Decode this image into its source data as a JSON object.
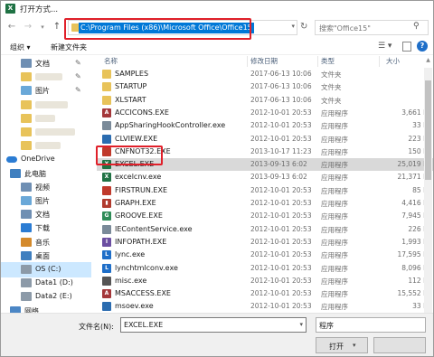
{
  "window": {
    "title": "打开方式...",
    "app_icon_letter": "X"
  },
  "address_bar": {
    "path": "C:\\Program Files (x86)\\Microsoft Office\\Office15",
    "search_placeholder": "搜索\"Office15\""
  },
  "toolbar": {
    "organize_label": "组织 ▾",
    "new_folder_label": "新建文件夹"
  },
  "sidebar": {
    "items": [
      {
        "label": "文档",
        "icon": "document-folder-icon",
        "pinned": true
      },
      {
        "label": "",
        "icon": "folder-icon",
        "pinned": true
      },
      {
        "label": "图片",
        "icon": "pictures-folder-icon",
        "pinned": true
      },
      {
        "label": "",
        "icon": "folder-icon",
        "pinned": false
      },
      {
        "label": "",
        "icon": "folder-icon",
        "pinned": false
      },
      {
        "label": "",
        "icon": "folder-icon",
        "pinned": false
      },
      {
        "label": "",
        "icon": "folder-icon",
        "pinned": false
      },
      {
        "label": "OneDrive",
        "icon": "onedrive-icon",
        "pinned": false
      },
      {
        "label": "此电脑",
        "icon": "this-pc-icon",
        "pinned": false
      },
      {
        "label": "视频",
        "icon": "videos-folder-icon",
        "pinned": false
      },
      {
        "label": "图片",
        "icon": "pictures-folder-icon",
        "pinned": false
      },
      {
        "label": "文档",
        "icon": "document-folder-icon",
        "pinned": false
      },
      {
        "label": "下载",
        "icon": "downloads-folder-icon",
        "pinned": false
      },
      {
        "label": "音乐",
        "icon": "music-folder-icon",
        "pinned": false
      },
      {
        "label": "桌面",
        "icon": "desktop-folder-icon",
        "pinned": false
      },
      {
        "label": "OS (C:)",
        "icon": "drive-icon",
        "pinned": false
      },
      {
        "label": "Data1 (D:)",
        "icon": "drive-icon",
        "pinned": false
      },
      {
        "label": "Data2 (E:)",
        "icon": "drive-icon",
        "pinned": false
      },
      {
        "label": "网络",
        "icon": "network-icon",
        "pinned": false
      }
    ]
  },
  "columns": {
    "name": "名称",
    "date": "修改日期",
    "type": "类型",
    "size": "大小"
  },
  "files": [
    {
      "name": "SAMPLES",
      "date": "2017-06-13 10:06",
      "type": "文件夹",
      "size": "",
      "icon": "folder-icon",
      "color": "#e8c35a"
    },
    {
      "name": "STARTUP",
      "date": "2017-06-13 10:06",
      "type": "文件夹",
      "size": "",
      "icon": "folder-icon",
      "color": "#e8c35a"
    },
    {
      "name": "XLSTART",
      "date": "2017-06-13 10:06",
      "type": "文件夹",
      "size": "",
      "icon": "folder-icon",
      "color": "#e8c35a"
    },
    {
      "name": "ACCICONS.EXE",
      "date": "2012-10-01 20:53",
      "type": "应用程序",
      "size": "3,661 K",
      "icon": "access-icon",
      "color": "#a4373a"
    },
    {
      "name": "AppSharingHookController.exe",
      "date": "2012-10-01 20:53",
      "type": "应用程序",
      "size": "33 K",
      "icon": "exe-icon",
      "color": "#7a8a99"
    },
    {
      "name": "CLVIEW.EXE",
      "date": "2012-10-01 20:53",
      "type": "应用程序",
      "size": "223 K",
      "icon": "exe-icon",
      "color": "#2b6cb0"
    },
    {
      "name": "CNFNOT32.EXE",
      "date": "2013-10-17 11:23",
      "type": "应用程序",
      "size": "150 K",
      "icon": "exe-icon",
      "color": "#c0392b"
    },
    {
      "name": "EXCEL.EXE",
      "date": "2013-09-13 6:02",
      "type": "应用程序",
      "size": "25,019 K",
      "icon": "excel-icon",
      "color": "#1f7244",
      "selected": true
    },
    {
      "name": "excelcnv.exe",
      "date": "2013-09-13 6:02",
      "type": "应用程序",
      "size": "21,371 K",
      "icon": "excel-icon",
      "color": "#1f7244"
    },
    {
      "name": "FIRSTRUN.EXE",
      "date": "2012-10-01 20:53",
      "type": "应用程序",
      "size": "85 K",
      "icon": "exe-icon",
      "color": "#c0392b"
    },
    {
      "name": "GRAPH.EXE",
      "date": "2012-10-01 20:53",
      "type": "应用程序",
      "size": "4,416 K",
      "icon": "graph-icon",
      "color": "#b03a2e"
    },
    {
      "name": "GROOVE.EXE",
      "date": "2012-10-01 20:53",
      "type": "应用程序",
      "size": "7,945 K",
      "icon": "groove-icon",
      "color": "#2e8b57"
    },
    {
      "name": "IEContentService.exe",
      "date": "2012-10-01 20:53",
      "type": "应用程序",
      "size": "226 K",
      "icon": "exe-icon",
      "color": "#7a8a99"
    },
    {
      "name": "INFOPATH.EXE",
      "date": "2012-10-01 20:53",
      "type": "应用程序",
      "size": "1,993 K",
      "icon": "infopath-icon",
      "color": "#6b4ea1"
    },
    {
      "name": "lync.exe",
      "date": "2012-10-01 20:53",
      "type": "应用程序",
      "size": "17,595 K",
      "icon": "lync-icon",
      "color": "#1e6ec8"
    },
    {
      "name": "lynchtmlconv.exe",
      "date": "2012-10-01 20:53",
      "type": "应用程序",
      "size": "8,096 K",
      "icon": "lync-icon",
      "color": "#1e6ec8"
    },
    {
      "name": "misc.exe",
      "date": "2012-10-01 20:53",
      "type": "应用程序",
      "size": "112 K",
      "icon": "exe-icon",
      "color": "#555555"
    },
    {
      "name": "MSACCESS.EXE",
      "date": "2012-10-01 20:53",
      "type": "应用程序",
      "size": "15,552 K",
      "icon": "access-icon",
      "color": "#a4373a"
    },
    {
      "name": "msoev.exe",
      "date": "2012-10-01 20:53",
      "type": "应用程序",
      "size": "33 K",
      "icon": "exe-icon",
      "color": "#2b6cb0"
    }
  ],
  "bottom": {
    "filename_label": "文件名(N):",
    "filename_value": "EXCEL.EXE",
    "filetype_value": "程序",
    "open_label": "打开",
    "cancel_label": ""
  }
}
